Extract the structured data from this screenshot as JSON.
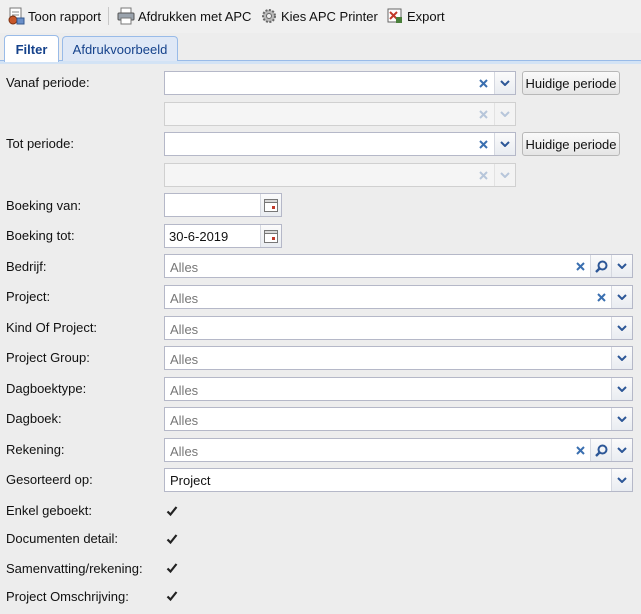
{
  "toolbar": {
    "show_report": "Toon rapport",
    "print_apc": "Afdrukken met APC",
    "choose_printer": "Kies APC Printer",
    "export": "Export"
  },
  "tabs": [
    {
      "label": "Filter",
      "active": true
    },
    {
      "label": "Afdrukvoorbeeld",
      "active": false
    }
  ],
  "form": {
    "vanaf_periode": {
      "label": "Vanaf periode:",
      "value": "",
      "sub_value": "",
      "current_button": "Huidige periode"
    },
    "tot_periode": {
      "label": "Tot periode:",
      "value": "",
      "sub_value": "",
      "current_button": "Huidige periode"
    },
    "boeking_van": {
      "label": "Boeking van:",
      "value": ""
    },
    "boeking_tot": {
      "label": "Boeking tot:",
      "value": "30-6-2019"
    },
    "bedrijf": {
      "label": "Bedrijf:",
      "placeholder": "Alles"
    },
    "project": {
      "label": "Project:",
      "placeholder": "Alles"
    },
    "kind_of_project": {
      "label": "Kind Of Project:",
      "placeholder": "Alles"
    },
    "project_group": {
      "label": "Project Group:",
      "placeholder": "Alles"
    },
    "dagboektype": {
      "label": "Dagboektype:",
      "placeholder": "Alles"
    },
    "dagboek": {
      "label": "Dagboek:",
      "placeholder": "Alles"
    },
    "rekening": {
      "label": "Rekening:",
      "placeholder": "Alles"
    },
    "gesorteerd_op": {
      "label": "Gesorteerd op:",
      "value": "Project"
    },
    "enkel_geboekt": {
      "label": "Enkel geboekt:",
      "checked": true
    },
    "documenten_detail": {
      "label": "Documenten detail:",
      "checked": true
    },
    "samenvatting_rekening": {
      "label": "Samenvatting/rekening:",
      "checked": true
    },
    "project_omschrijving": {
      "label": "Project Omschrijving:",
      "checked": true
    }
  },
  "colors": {
    "tab_text": "#15428b",
    "tab_border": "#99bbe8",
    "clear_icon": "#3a6fb0"
  },
  "icons": [
    "report-icon",
    "printer-icon",
    "gear-printer-icon",
    "export-icon",
    "clear-icon",
    "chevron-down-icon",
    "search-icon",
    "calendar-icon",
    "checkbox-checked-icon"
  ]
}
